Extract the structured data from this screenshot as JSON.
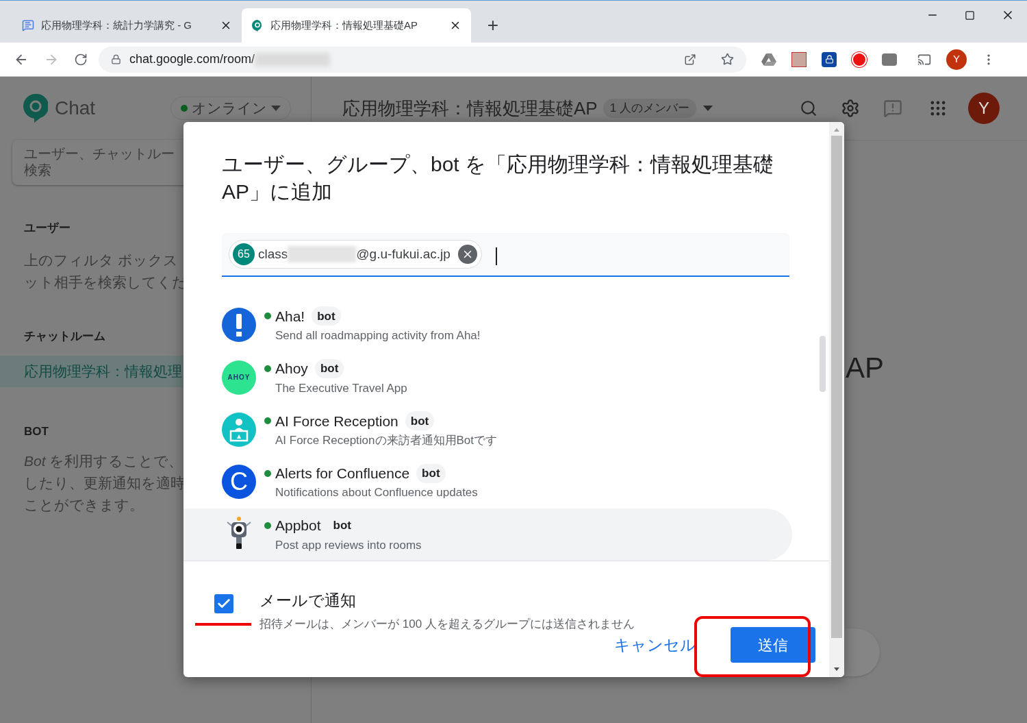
{
  "browser": {
    "tabs": [
      {
        "title": "応用物理学科：統計力学講究 - G",
        "selected": false
      },
      {
        "title": "応用物理学科：情報処理基礎AP",
        "selected": true
      }
    ],
    "new_tab": "+",
    "url": "chat.google.com/room/",
    "profile_initial": "Y"
  },
  "app": {
    "logo_text": "Chat",
    "status": {
      "label": "オンライン",
      "online": true
    },
    "search_placeholder": [
      "ユーザー、チャットルー",
      "検索"
    ],
    "users": {
      "heading": "ユーザー",
      "lines": [
        "上のフィルタ ボックス",
        "ット相手を検索してくだ"
      ]
    },
    "rooms": {
      "heading": "チャットルーム",
      "items": [
        {
          "name": "応用物理学科：情報処理",
          "selected": true
        }
      ]
    },
    "bots": {
      "heading": "BOT",
      "lines": [
        "*Bot* を利用することで、",
        "したり、更新通知を適時",
        "ことができます。"
      ]
    },
    "header": {
      "room_title": "応用物理学科：情報処理基礎AP",
      "member_count": "1 人のメンバー",
      "avatar_initial": "Y"
    },
    "background_title": "AP"
  },
  "dialog": {
    "title": "ユーザー、グループ、bot を「応用物理学科：情報処理基礎AP」に追加",
    "chip": {
      "badge": "65",
      "prefix": "class",
      "suffix": "@g.u-fukui.ac.jp"
    },
    "results": [
      {
        "name": "Aha!",
        "tag": "bot",
        "description": "Send all roadmapping activity from Aha!",
        "online": true,
        "kind": "exclamation",
        "highlighted": false
      },
      {
        "name": "Ahoy",
        "tag": "bot",
        "description": "The Executive Travel App",
        "online": true,
        "kind": "ahoy",
        "logo_text": "AHOY",
        "highlighted": false
      },
      {
        "name": "AI Force Reception",
        "tag": "bot",
        "description": "AI Force Receptionの来訪者通知用Botです",
        "online": true,
        "kind": "reception",
        "highlighted": false
      },
      {
        "name": "Alerts for Confluence",
        "tag": "bot",
        "description": "Notifications about Confluence updates",
        "online": true,
        "kind": "letter",
        "logo_text": "C",
        "highlighted": false
      },
      {
        "name": "Appbot",
        "tag": "bot",
        "description": "Post app reviews into rooms",
        "online": true,
        "kind": "robot",
        "highlighted": true
      }
    ],
    "notify": {
      "checked": true,
      "label": "メールで通知",
      "hint": "招待メールは、メンバーが 100 人を超えるグループには送信されません"
    },
    "cancel": "キャンセル",
    "send": "送信"
  }
}
